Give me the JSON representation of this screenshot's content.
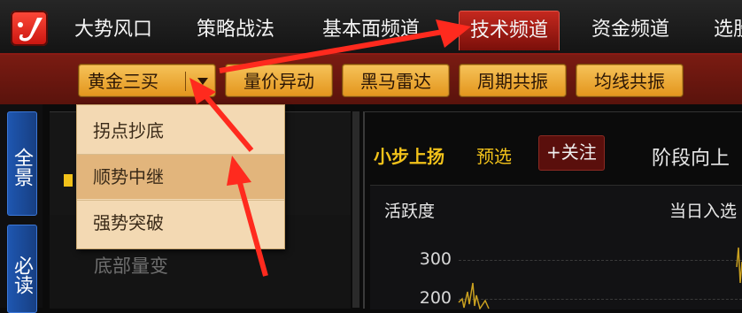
{
  "nav": {
    "items": [
      {
        "label": "大势风口"
      },
      {
        "label": "策略战法"
      },
      {
        "label": "基本面频道"
      },
      {
        "label": "技术频道",
        "active": true
      },
      {
        "label": "资金频道"
      },
      {
        "label": "选股"
      }
    ]
  },
  "toolbar": {
    "dropdown_label": "黄金三买",
    "buttons": [
      "量价异动",
      "黑马雷达",
      "周期共振",
      "均线共振"
    ]
  },
  "dropdown": {
    "items": [
      "拐点抄底",
      "顺势中继",
      "强势突破"
    ],
    "selected_index": 1
  },
  "sidebar": {
    "tabs": [
      "全景",
      "必读"
    ]
  },
  "left_panel": {
    "bottom_item": "底部量变"
  },
  "right_panel": {
    "title": "小步上扬",
    "preselect": "预选",
    "follow_button": "+关注",
    "stage_text": "阶段向上"
  },
  "chart": {
    "left_label": "活跃度",
    "right_label": "当日入选",
    "y_ticks": [
      "300",
      "200"
    ]
  },
  "colors": {
    "accent_red": "#c4281e",
    "gold_button": "#f0b040",
    "highlight_yellow": "#f2c21a",
    "annotation_arrow": "#ff2a1e"
  }
}
